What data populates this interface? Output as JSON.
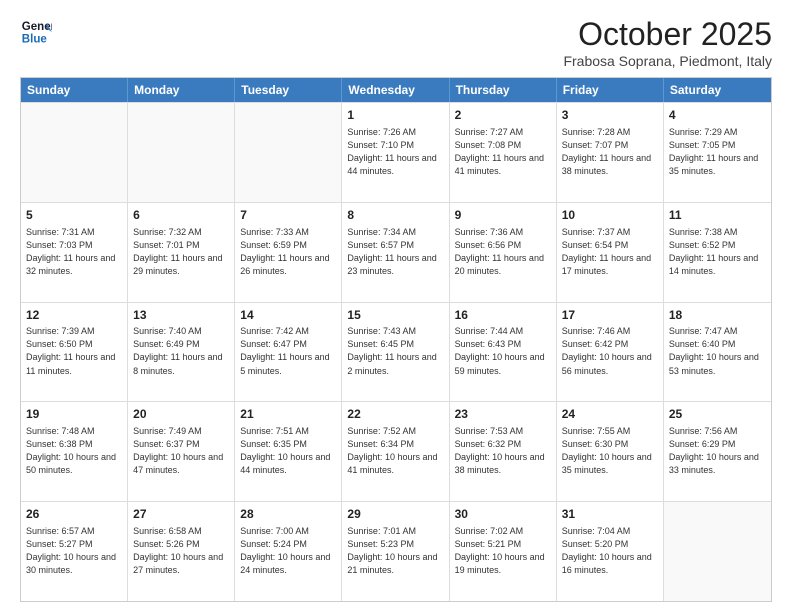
{
  "header": {
    "logo_line1": "General",
    "logo_line2": "Blue",
    "month_title": "October 2025",
    "location": "Frabosa Soprana, Piedmont, Italy"
  },
  "days_of_week": [
    "Sunday",
    "Monday",
    "Tuesday",
    "Wednesday",
    "Thursday",
    "Friday",
    "Saturday"
  ],
  "rows": [
    [
      {
        "day": "",
        "sunrise": "",
        "sunset": "",
        "daylight": "",
        "empty": true
      },
      {
        "day": "",
        "sunrise": "",
        "sunset": "",
        "daylight": "",
        "empty": true
      },
      {
        "day": "",
        "sunrise": "",
        "sunset": "",
        "daylight": "",
        "empty": true
      },
      {
        "day": "1",
        "sunrise": "Sunrise: 7:26 AM",
        "sunset": "Sunset: 7:10 PM",
        "daylight": "Daylight: 11 hours and 44 minutes."
      },
      {
        "day": "2",
        "sunrise": "Sunrise: 7:27 AM",
        "sunset": "Sunset: 7:08 PM",
        "daylight": "Daylight: 11 hours and 41 minutes."
      },
      {
        "day": "3",
        "sunrise": "Sunrise: 7:28 AM",
        "sunset": "Sunset: 7:07 PM",
        "daylight": "Daylight: 11 hours and 38 minutes."
      },
      {
        "day": "4",
        "sunrise": "Sunrise: 7:29 AM",
        "sunset": "Sunset: 7:05 PM",
        "daylight": "Daylight: 11 hours and 35 minutes."
      }
    ],
    [
      {
        "day": "5",
        "sunrise": "Sunrise: 7:31 AM",
        "sunset": "Sunset: 7:03 PM",
        "daylight": "Daylight: 11 hours and 32 minutes."
      },
      {
        "day": "6",
        "sunrise": "Sunrise: 7:32 AM",
        "sunset": "Sunset: 7:01 PM",
        "daylight": "Daylight: 11 hours and 29 minutes."
      },
      {
        "day": "7",
        "sunrise": "Sunrise: 7:33 AM",
        "sunset": "Sunset: 6:59 PM",
        "daylight": "Daylight: 11 hours and 26 minutes."
      },
      {
        "day": "8",
        "sunrise": "Sunrise: 7:34 AM",
        "sunset": "Sunset: 6:57 PM",
        "daylight": "Daylight: 11 hours and 23 minutes."
      },
      {
        "day": "9",
        "sunrise": "Sunrise: 7:36 AM",
        "sunset": "Sunset: 6:56 PM",
        "daylight": "Daylight: 11 hours and 20 minutes."
      },
      {
        "day": "10",
        "sunrise": "Sunrise: 7:37 AM",
        "sunset": "Sunset: 6:54 PM",
        "daylight": "Daylight: 11 hours and 17 minutes."
      },
      {
        "day": "11",
        "sunrise": "Sunrise: 7:38 AM",
        "sunset": "Sunset: 6:52 PM",
        "daylight": "Daylight: 11 hours and 14 minutes."
      }
    ],
    [
      {
        "day": "12",
        "sunrise": "Sunrise: 7:39 AM",
        "sunset": "Sunset: 6:50 PM",
        "daylight": "Daylight: 11 hours and 11 minutes."
      },
      {
        "day": "13",
        "sunrise": "Sunrise: 7:40 AM",
        "sunset": "Sunset: 6:49 PM",
        "daylight": "Daylight: 11 hours and 8 minutes."
      },
      {
        "day": "14",
        "sunrise": "Sunrise: 7:42 AM",
        "sunset": "Sunset: 6:47 PM",
        "daylight": "Daylight: 11 hours and 5 minutes."
      },
      {
        "day": "15",
        "sunrise": "Sunrise: 7:43 AM",
        "sunset": "Sunset: 6:45 PM",
        "daylight": "Daylight: 11 hours and 2 minutes."
      },
      {
        "day": "16",
        "sunrise": "Sunrise: 7:44 AM",
        "sunset": "Sunset: 6:43 PM",
        "daylight": "Daylight: 10 hours and 59 minutes."
      },
      {
        "day": "17",
        "sunrise": "Sunrise: 7:46 AM",
        "sunset": "Sunset: 6:42 PM",
        "daylight": "Daylight: 10 hours and 56 minutes."
      },
      {
        "day": "18",
        "sunrise": "Sunrise: 7:47 AM",
        "sunset": "Sunset: 6:40 PM",
        "daylight": "Daylight: 10 hours and 53 minutes."
      }
    ],
    [
      {
        "day": "19",
        "sunrise": "Sunrise: 7:48 AM",
        "sunset": "Sunset: 6:38 PM",
        "daylight": "Daylight: 10 hours and 50 minutes."
      },
      {
        "day": "20",
        "sunrise": "Sunrise: 7:49 AM",
        "sunset": "Sunset: 6:37 PM",
        "daylight": "Daylight: 10 hours and 47 minutes."
      },
      {
        "day": "21",
        "sunrise": "Sunrise: 7:51 AM",
        "sunset": "Sunset: 6:35 PM",
        "daylight": "Daylight: 10 hours and 44 minutes."
      },
      {
        "day": "22",
        "sunrise": "Sunrise: 7:52 AM",
        "sunset": "Sunset: 6:34 PM",
        "daylight": "Daylight: 10 hours and 41 minutes."
      },
      {
        "day": "23",
        "sunrise": "Sunrise: 7:53 AM",
        "sunset": "Sunset: 6:32 PM",
        "daylight": "Daylight: 10 hours and 38 minutes."
      },
      {
        "day": "24",
        "sunrise": "Sunrise: 7:55 AM",
        "sunset": "Sunset: 6:30 PM",
        "daylight": "Daylight: 10 hours and 35 minutes."
      },
      {
        "day": "25",
        "sunrise": "Sunrise: 7:56 AM",
        "sunset": "Sunset: 6:29 PM",
        "daylight": "Daylight: 10 hours and 33 minutes."
      }
    ],
    [
      {
        "day": "26",
        "sunrise": "Sunrise: 6:57 AM",
        "sunset": "Sunset: 5:27 PM",
        "daylight": "Daylight: 10 hours and 30 minutes."
      },
      {
        "day": "27",
        "sunrise": "Sunrise: 6:58 AM",
        "sunset": "Sunset: 5:26 PM",
        "daylight": "Daylight: 10 hours and 27 minutes."
      },
      {
        "day": "28",
        "sunrise": "Sunrise: 7:00 AM",
        "sunset": "Sunset: 5:24 PM",
        "daylight": "Daylight: 10 hours and 24 minutes."
      },
      {
        "day": "29",
        "sunrise": "Sunrise: 7:01 AM",
        "sunset": "Sunset: 5:23 PM",
        "daylight": "Daylight: 10 hours and 21 minutes."
      },
      {
        "day": "30",
        "sunrise": "Sunrise: 7:02 AM",
        "sunset": "Sunset: 5:21 PM",
        "daylight": "Daylight: 10 hours and 19 minutes."
      },
      {
        "day": "31",
        "sunrise": "Sunrise: 7:04 AM",
        "sunset": "Sunset: 5:20 PM",
        "daylight": "Daylight: 10 hours and 16 minutes."
      },
      {
        "day": "",
        "sunrise": "",
        "sunset": "",
        "daylight": "",
        "empty": true
      }
    ]
  ]
}
